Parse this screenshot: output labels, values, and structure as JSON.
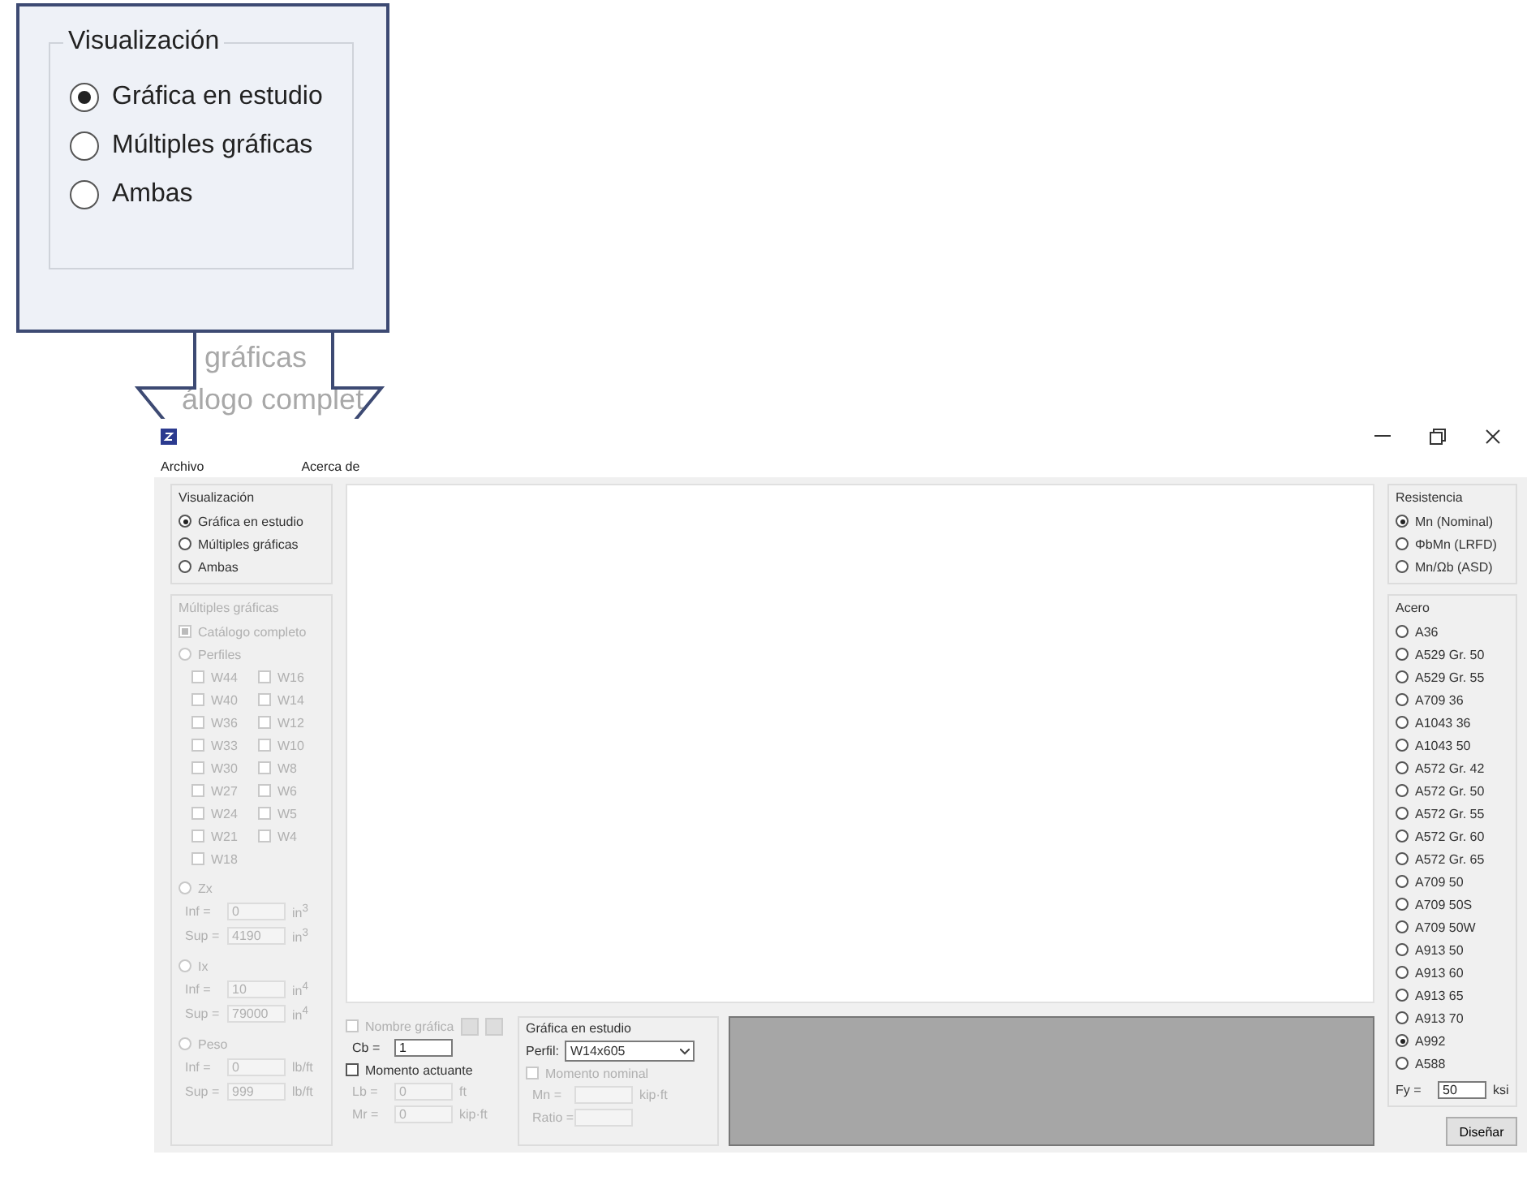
{
  "callout": {
    "title": "Visualización",
    "options": [
      {
        "label": "Gráfica en estudio",
        "selected": true
      },
      {
        "label": "Múltiples gráficas",
        "selected": false
      },
      {
        "label": "Ambas",
        "selected": false
      }
    ],
    "magnified_texts": [
      "gráficas",
      "álogo complet"
    ]
  },
  "window": {
    "menu": [
      "Archivo",
      "Acerca de"
    ]
  },
  "visualization": {
    "title": "Visualización",
    "options": [
      {
        "label": "Gráfica en estudio",
        "selected": true
      },
      {
        "label": "Múltiples gráficas",
        "selected": false
      },
      {
        "label": "Ambas",
        "selected": false
      }
    ]
  },
  "multiple": {
    "title": "Múltiples gráficas",
    "disabled": true,
    "catalog": {
      "label": "Catálogo completo",
      "checked": true
    },
    "profiles": {
      "label": "Perfiles",
      "selected": false,
      "items": [
        {
          "label": "W44",
          "checked": false
        },
        {
          "label": "W16",
          "checked": false
        },
        {
          "label": "W40",
          "checked": false
        },
        {
          "label": "W14",
          "checked": false
        },
        {
          "label": "W36",
          "checked": false
        },
        {
          "label": "W12",
          "checked": false
        },
        {
          "label": "W33",
          "checked": false
        },
        {
          "label": "W10",
          "checked": false
        },
        {
          "label": "W30",
          "checked": false
        },
        {
          "label": "W8",
          "checked": false
        },
        {
          "label": "W27",
          "checked": false
        },
        {
          "label": "W6",
          "checked": false
        },
        {
          "label": "W24",
          "checked": false
        },
        {
          "label": "W5",
          "checked": false
        },
        {
          "label": "W21",
          "checked": false
        },
        {
          "label": "W4",
          "checked": false
        },
        {
          "label": "W18",
          "checked": false
        }
      ]
    },
    "filters": [
      {
        "label": "Zx",
        "selected": false,
        "rows": [
          {
            "label": "Inf =",
            "value": "0",
            "unit": "in$^{3}$"
          },
          {
            "label": "Sup =",
            "value": "4190",
            "unit": "in$^{3}$"
          }
        ]
      },
      {
        "label": "Ix",
        "selected": false,
        "rows": [
          {
            "label": "Inf =",
            "value": "10",
            "unit": "in$^{4}$"
          },
          {
            "label": "Sup =",
            "value": "79000",
            "unit": "in$^{4}$"
          }
        ]
      },
      {
        "label": "Peso",
        "selected": false,
        "rows": [
          {
            "label": "Inf =",
            "value": "0",
            "unit": "lb/ft"
          },
          {
            "label": "Sup =",
            "value": "999",
            "unit": "lb/ft"
          }
        ]
      }
    ]
  },
  "graph_options": {
    "name_label": "Nombre gráfica",
    "name_checked": false,
    "disabled": true,
    "cb_label": "Cb =",
    "cb_value": "1",
    "moment": {
      "label": "Momento actuante",
      "checked": false
    },
    "rows": [
      {
        "label": "Lb =",
        "value": "0",
        "unit": "ft"
      },
      {
        "label": "Mr =",
        "value": "0",
        "unit": "kip·ft"
      }
    ]
  },
  "study": {
    "title": "Gráfica en estudio",
    "profile_label": "Perfil:",
    "profile_value": "W14x605",
    "nominal": {
      "label": "Momento nominal",
      "checked": false,
      "disabled": true
    },
    "rows": [
      {
        "label": "Mn =",
        "unit": "kip·ft"
      },
      {
        "label": "Ratio ="
      }
    ]
  },
  "resistance": {
    "title": "Resistencia",
    "options": [
      {
        "label": "Mn (Nominal)",
        "selected": true
      },
      {
        "label": "ΦbMn (LRFD)",
        "selected": false
      },
      {
        "label": "Mn/Ωb (ASD)",
        "selected": false
      }
    ]
  },
  "steel": {
    "title": "Acero",
    "options": [
      {
        "label": "A36",
        "selected": false
      },
      {
        "label": "A529 Gr. 50",
        "selected": false
      },
      {
        "label": "A529 Gr. 55",
        "selected": false
      },
      {
        "label": "A709 36",
        "selected": false
      },
      {
        "label": "A1043 36",
        "selected": false
      },
      {
        "label": "A1043 50",
        "selected": false
      },
      {
        "label": "A572 Gr. 42",
        "selected": false
      },
      {
        "label": "A572 Gr. 50",
        "selected": false
      },
      {
        "label": "A572 Gr. 55",
        "selected": false
      },
      {
        "label": "A572 Gr. 60",
        "selected": false
      },
      {
        "label": "A572 Gr. 65",
        "selected": false
      },
      {
        "label": "A709 50",
        "selected": false
      },
      {
        "label": "A709 50S",
        "selected": false
      },
      {
        "label": "A709 50W",
        "selected": false
      },
      {
        "label": "A913 50",
        "selected": false
      },
      {
        "label": "A913 60",
        "selected": false
      },
      {
        "label": "A913 65",
        "selected": false
      },
      {
        "label": "A913 70",
        "selected": false
      },
      {
        "label": "A992",
        "selected": true
      },
      {
        "label": "A588",
        "selected": false
      }
    ],
    "fy_label": "Fy =",
    "fy_value": "50",
    "fy_unit": "ksi"
  },
  "design_button": "Diseñar"
}
